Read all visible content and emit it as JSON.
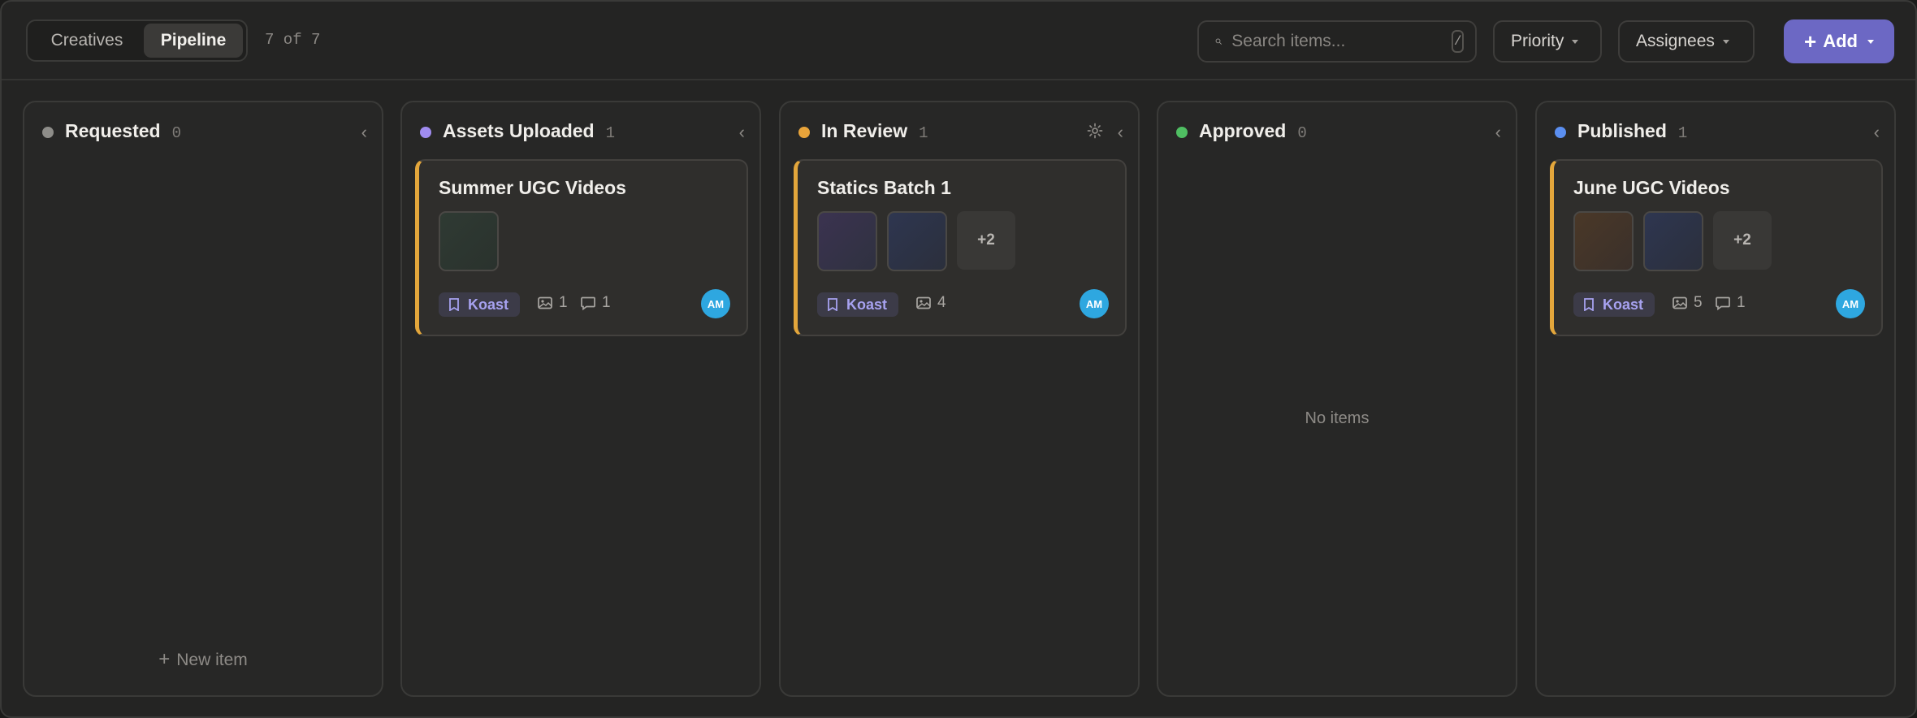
{
  "toolbar": {
    "tabs": [
      "Creatives",
      "Pipeline"
    ],
    "active_tab": "Pipeline",
    "count_text": "7 of 7",
    "search_placeholder": "Search items...",
    "search_shortcut": "/",
    "priority_label": "Priority",
    "assignees_label": "Assignees",
    "add_label": "Add"
  },
  "colors": {
    "accent": "#6c68c4",
    "card_border": "#e3a63b",
    "avatar": "#2ea7e0",
    "tag_text": "#a7a2f0"
  },
  "columns": [
    {
      "title": "Requested",
      "count": "0",
      "dot_color": "#8e8d89",
      "new_item_label": "New item"
    },
    {
      "title": "Assets Uploaded",
      "count": "1",
      "dot_color": "#a08cf0",
      "card": {
        "title": "Summer UGC Videos",
        "tag": "Koast",
        "images": "1",
        "comments": "1",
        "assignee": "AM"
      }
    },
    {
      "title": "In Review",
      "count": "1",
      "dot_color": "#e9a43a",
      "card": {
        "title": "Statics Batch 1",
        "tag": "Koast",
        "images": "4",
        "more": "+2",
        "assignee": "AM"
      }
    },
    {
      "title": "Approved",
      "count": "0",
      "dot_color": "#4fbf62",
      "empty_label": "No items"
    },
    {
      "title": "Published",
      "count": "1",
      "dot_color": "#5b8ff0",
      "card": {
        "title": "June UGC Videos",
        "tag": "Koast",
        "images": "5",
        "comments": "1",
        "more": "+2",
        "assignee": "AM"
      }
    }
  ],
  "icons": [
    "search-icon",
    "chevron-left-icon",
    "gear-icon",
    "bookmark-icon",
    "image-icon",
    "comment-icon",
    "plus-icon",
    "chevron-down-icon"
  ]
}
